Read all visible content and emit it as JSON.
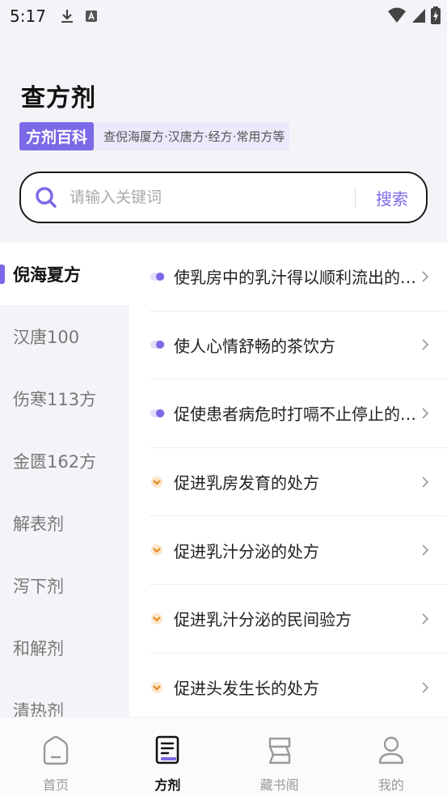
{
  "status_bar": {
    "time": "5:17"
  },
  "header": {
    "title": "查方剂",
    "badge": "方剂百科",
    "subtitle": "查倪海厦方·汉唐方·经方·常用方等"
  },
  "search": {
    "placeholder": "请输入关键词",
    "value": "",
    "button_label": "搜索"
  },
  "sidebar": {
    "items": [
      {
        "label": "倪海夏方",
        "active": true
      },
      {
        "label": "汉唐100"
      },
      {
        "label": "伤寒113方"
      },
      {
        "label": "金匮162方"
      },
      {
        "label": "解表剂"
      },
      {
        "label": "泻下剂"
      },
      {
        "label": "和解剂"
      },
      {
        "label": "清热剂"
      }
    ]
  },
  "list": {
    "items": [
      {
        "label": "使乳房中的乳汁得以顺利流出的处方",
        "icon": "purple-dot-icon"
      },
      {
        "label": "使人心情舒畅的茶饮方",
        "icon": "purple-dot-icon"
      },
      {
        "label": "促使患者病危时打嗝不止停止的处方",
        "icon": "purple-dot-icon"
      },
      {
        "label": "促进乳房发育的处方",
        "icon": "orange-chevron-icon"
      },
      {
        "label": "促进乳汁分泌的处方",
        "icon": "orange-chevron-icon"
      },
      {
        "label": "促进乳汁分泌的民间验方",
        "icon": "orange-chevron-icon"
      },
      {
        "label": "促进头发生长的处方",
        "icon": "orange-chevron-icon"
      }
    ]
  },
  "bottom_nav": {
    "items": [
      {
        "label": "首页",
        "icon": "home-icon"
      },
      {
        "label": "方剂",
        "icon": "prescription-icon",
        "active": true
      },
      {
        "label": "藏书阁",
        "icon": "library-icon"
      },
      {
        "label": "我的",
        "icon": "profile-icon"
      }
    ]
  },
  "colors": {
    "accent": "#7b6ae8",
    "orange": "#f0a64a"
  }
}
